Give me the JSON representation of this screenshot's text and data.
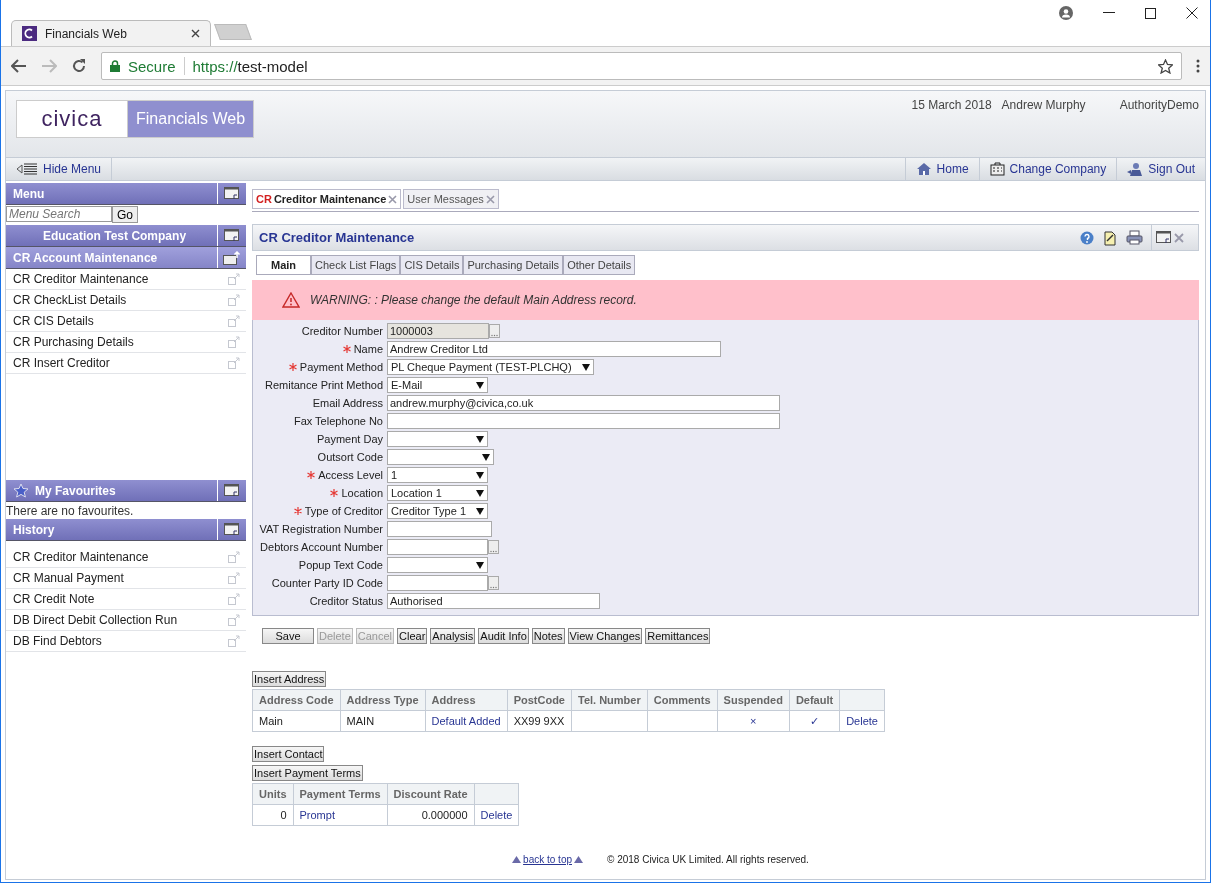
{
  "browser": {
    "tab_title": "Financials Web",
    "secure_label": "Secure",
    "url_scheme": "https://",
    "url_host": "test-model"
  },
  "header": {
    "logo": "civica",
    "product": "Financials Web",
    "date": "15 March 2018",
    "user": "Andrew Murphy",
    "authority": "AuthorityDemo"
  },
  "nav": {
    "hide_menu": "Hide Menu",
    "links": [
      {
        "kind": "home",
        "label": "Home"
      },
      {
        "kind": "company",
        "label": "Change Company"
      },
      {
        "kind": "signout",
        "label": "Sign Out"
      }
    ]
  },
  "sidebar": {
    "menu_title": "Menu",
    "search_placeholder": "Menu Search",
    "go": "Go",
    "company": "Education Test Company",
    "section": "CR Account Maintenance",
    "items": [
      "CR Creditor Maintenance",
      "CR CheckList Details",
      "CR CIS Details",
      "CR Purchasing Details",
      "CR Insert Creditor"
    ],
    "favourites_title": "My Favourites",
    "favourites_empty": "There are no favourites.",
    "history_title": "History",
    "history_items": [
      "CR Creditor Maintenance",
      "CR Manual Payment",
      "CR Credit Note",
      "DB Direct Debit Collection Run",
      "DB Find Debtors"
    ]
  },
  "page_tabs": [
    {
      "prefix": "CR",
      "label": "Creditor Maintenance",
      "selected": true
    },
    {
      "label": "User Messages",
      "selected": false
    }
  ],
  "panel_title": "CR Creditor Maintenance",
  "form_tabs": [
    {
      "label": "Main",
      "selected": true
    },
    {
      "label": "Check List Flags",
      "selected": false
    },
    {
      "label": "CIS Details",
      "selected": false
    },
    {
      "label": "Purchasing Details",
      "selected": false
    },
    {
      "label": "Other Details",
      "selected": false
    }
  ],
  "warning": "WARNING: : Please change the default Main Address record.",
  "fields": [
    {
      "label": "Creditor Number",
      "required": false,
      "kind": "lookup",
      "value": "1000003",
      "readonly": true
    },
    {
      "label": "Name",
      "required": true,
      "kind": "text",
      "value": "Andrew Creditor Ltd",
      "readonly": false
    },
    {
      "label": "Payment Method",
      "required": true,
      "kind": "select",
      "value": "PL Cheque Payment (TEST-PLCHQ)",
      "readonly": false
    },
    {
      "label": "Remitance Print Method",
      "required": false,
      "kind": "select",
      "value": "E-Mail",
      "readonly": false
    },
    {
      "label": "Email Address",
      "required": false,
      "kind": "text",
      "value": "andrew.murphy@civica,co.uk",
      "readonly": false
    },
    {
      "label": "Fax Telephone No",
      "required": false,
      "kind": "text",
      "readonly": false
    },
    {
      "label": "Payment Day",
      "required": false,
      "kind": "select",
      "readonly": false
    },
    {
      "label": "Outsort Code",
      "required": false,
      "kind": "select",
      "readonly": false
    },
    {
      "label": "Access Level",
      "required": true,
      "kind": "select",
      "value": "1",
      "readonly": false
    },
    {
      "label": "Location",
      "required": true,
      "kind": "select",
      "value": "Location 1",
      "readonly": false
    },
    {
      "label": "Type of Creditor",
      "required": true,
      "kind": "select",
      "value": "Creditor Type 1",
      "readonly": false
    },
    {
      "label": "VAT Registration Number",
      "required": false,
      "kind": "text",
      "readonly": false
    },
    {
      "label": "Debtors Account Number",
      "required": false,
      "kind": "lookup",
      "readonly": false
    },
    {
      "label": "Popup Text Code",
      "required": false,
      "kind": "select",
      "readonly": false
    },
    {
      "label": "Counter Party ID Code",
      "required": false,
      "kind": "lookup",
      "readonly": false
    },
    {
      "label": "Creditor Status",
      "required": false,
      "kind": "text",
      "value": "Authorised",
      "readonly": false
    }
  ],
  "buttons": [
    {
      "label": "Save",
      "disabled": false
    },
    {
      "label": "Delete",
      "disabled": true
    },
    {
      "label": "Cancel",
      "disabled": true
    },
    {
      "label": "Clear",
      "disabled": false
    },
    {
      "label": "Analysis",
      "disabled": false
    },
    {
      "label": "Audit Info",
      "disabled": false
    },
    {
      "label": "Notes",
      "disabled": false
    },
    {
      "label": "View Changes",
      "disabled": false
    },
    {
      "label": "Remittances",
      "disabled": false
    }
  ],
  "insert_address": "Insert Address",
  "address_table": {
    "columns": [
      "Address Code",
      "Address Type",
      "Address",
      "PostCode",
      "Tel. Number",
      "Comments",
      "Suspended",
      "Default"
    ],
    "rows": [
      [
        {
          "text": "Main",
          "kind": "text"
        },
        {
          "text": "MAIN",
          "kind": "text"
        },
        {
          "text": "Default Added",
          "kind": "link"
        },
        {
          "text": "XX99 9XX",
          "kind": "text"
        },
        {
          "text": "",
          "kind": "text"
        },
        {
          "text": "",
          "kind": "text"
        },
        {
          "text": "×",
          "kind": "mark"
        },
        {
          "text": "✓",
          "kind": "mark"
        },
        {
          "text": "Delete",
          "kind": "link"
        }
      ]
    ]
  },
  "insert_contact": "Insert Contact",
  "insert_payment_terms": "Insert Payment Terms",
  "terms_table": {
    "columns": [
      "Units",
      "Payment Terms",
      "Discount Rate"
    ],
    "rows": [
      [
        {
          "text": "0",
          "kind": "number"
        },
        {
          "text": "Prompt",
          "kind": "link"
        },
        {
          "text": "0.000000",
          "kind": "number"
        },
        {
          "text": "Delete",
          "kind": "link"
        }
      ]
    ]
  },
  "footer": {
    "back_to_top": "back to top",
    "copyright": "© 2018 Civica UK Limited. All rights reserved."
  }
}
